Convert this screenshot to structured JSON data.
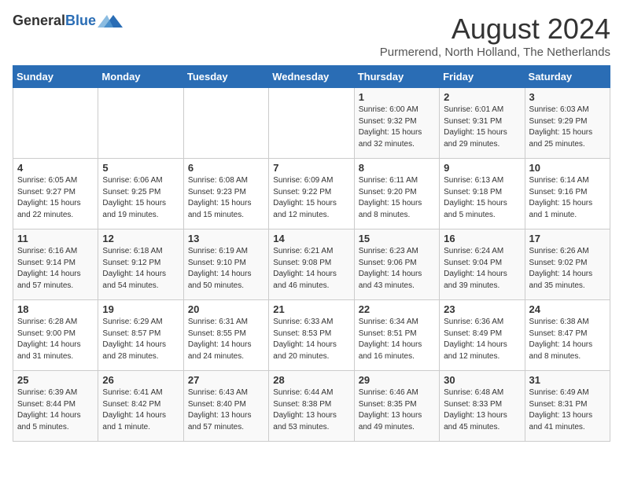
{
  "header": {
    "logo_general": "General",
    "logo_blue": "Blue",
    "month_year": "August 2024",
    "location": "Purmerend, North Holland, The Netherlands"
  },
  "weekdays": [
    "Sunday",
    "Monday",
    "Tuesday",
    "Wednesday",
    "Thursday",
    "Friday",
    "Saturday"
  ],
  "weeks": [
    [
      {
        "day": "",
        "info": ""
      },
      {
        "day": "",
        "info": ""
      },
      {
        "day": "",
        "info": ""
      },
      {
        "day": "",
        "info": ""
      },
      {
        "day": "1",
        "info": "Sunrise: 6:00 AM\nSunset: 9:32 PM\nDaylight: 15 hours\nand 32 minutes."
      },
      {
        "day": "2",
        "info": "Sunrise: 6:01 AM\nSunset: 9:31 PM\nDaylight: 15 hours\nand 29 minutes."
      },
      {
        "day": "3",
        "info": "Sunrise: 6:03 AM\nSunset: 9:29 PM\nDaylight: 15 hours\nand 25 minutes."
      }
    ],
    [
      {
        "day": "4",
        "info": "Sunrise: 6:05 AM\nSunset: 9:27 PM\nDaylight: 15 hours\nand 22 minutes."
      },
      {
        "day": "5",
        "info": "Sunrise: 6:06 AM\nSunset: 9:25 PM\nDaylight: 15 hours\nand 19 minutes."
      },
      {
        "day": "6",
        "info": "Sunrise: 6:08 AM\nSunset: 9:23 PM\nDaylight: 15 hours\nand 15 minutes."
      },
      {
        "day": "7",
        "info": "Sunrise: 6:09 AM\nSunset: 9:22 PM\nDaylight: 15 hours\nand 12 minutes."
      },
      {
        "day": "8",
        "info": "Sunrise: 6:11 AM\nSunset: 9:20 PM\nDaylight: 15 hours\nand 8 minutes."
      },
      {
        "day": "9",
        "info": "Sunrise: 6:13 AM\nSunset: 9:18 PM\nDaylight: 15 hours\nand 5 minutes."
      },
      {
        "day": "10",
        "info": "Sunrise: 6:14 AM\nSunset: 9:16 PM\nDaylight: 15 hours\nand 1 minute."
      }
    ],
    [
      {
        "day": "11",
        "info": "Sunrise: 6:16 AM\nSunset: 9:14 PM\nDaylight: 14 hours\nand 57 minutes."
      },
      {
        "day": "12",
        "info": "Sunrise: 6:18 AM\nSunset: 9:12 PM\nDaylight: 14 hours\nand 54 minutes."
      },
      {
        "day": "13",
        "info": "Sunrise: 6:19 AM\nSunset: 9:10 PM\nDaylight: 14 hours\nand 50 minutes."
      },
      {
        "day": "14",
        "info": "Sunrise: 6:21 AM\nSunset: 9:08 PM\nDaylight: 14 hours\nand 46 minutes."
      },
      {
        "day": "15",
        "info": "Sunrise: 6:23 AM\nSunset: 9:06 PM\nDaylight: 14 hours\nand 43 minutes."
      },
      {
        "day": "16",
        "info": "Sunrise: 6:24 AM\nSunset: 9:04 PM\nDaylight: 14 hours\nand 39 minutes."
      },
      {
        "day": "17",
        "info": "Sunrise: 6:26 AM\nSunset: 9:02 PM\nDaylight: 14 hours\nand 35 minutes."
      }
    ],
    [
      {
        "day": "18",
        "info": "Sunrise: 6:28 AM\nSunset: 9:00 PM\nDaylight: 14 hours\nand 31 minutes."
      },
      {
        "day": "19",
        "info": "Sunrise: 6:29 AM\nSunset: 8:57 PM\nDaylight: 14 hours\nand 28 minutes."
      },
      {
        "day": "20",
        "info": "Sunrise: 6:31 AM\nSunset: 8:55 PM\nDaylight: 14 hours\nand 24 minutes."
      },
      {
        "day": "21",
        "info": "Sunrise: 6:33 AM\nSunset: 8:53 PM\nDaylight: 14 hours\nand 20 minutes."
      },
      {
        "day": "22",
        "info": "Sunrise: 6:34 AM\nSunset: 8:51 PM\nDaylight: 14 hours\nand 16 minutes."
      },
      {
        "day": "23",
        "info": "Sunrise: 6:36 AM\nSunset: 8:49 PM\nDaylight: 14 hours\nand 12 minutes."
      },
      {
        "day": "24",
        "info": "Sunrise: 6:38 AM\nSunset: 8:47 PM\nDaylight: 14 hours\nand 8 minutes."
      }
    ],
    [
      {
        "day": "25",
        "info": "Sunrise: 6:39 AM\nSunset: 8:44 PM\nDaylight: 14 hours\nand 5 minutes."
      },
      {
        "day": "26",
        "info": "Sunrise: 6:41 AM\nSunset: 8:42 PM\nDaylight: 14 hours\nand 1 minute."
      },
      {
        "day": "27",
        "info": "Sunrise: 6:43 AM\nSunset: 8:40 PM\nDaylight: 13 hours\nand 57 minutes."
      },
      {
        "day": "28",
        "info": "Sunrise: 6:44 AM\nSunset: 8:38 PM\nDaylight: 13 hours\nand 53 minutes."
      },
      {
        "day": "29",
        "info": "Sunrise: 6:46 AM\nSunset: 8:35 PM\nDaylight: 13 hours\nand 49 minutes."
      },
      {
        "day": "30",
        "info": "Sunrise: 6:48 AM\nSunset: 8:33 PM\nDaylight: 13 hours\nand 45 minutes."
      },
      {
        "day": "31",
        "info": "Sunrise: 6:49 AM\nSunset: 8:31 PM\nDaylight: 13 hours\nand 41 minutes."
      }
    ]
  ]
}
